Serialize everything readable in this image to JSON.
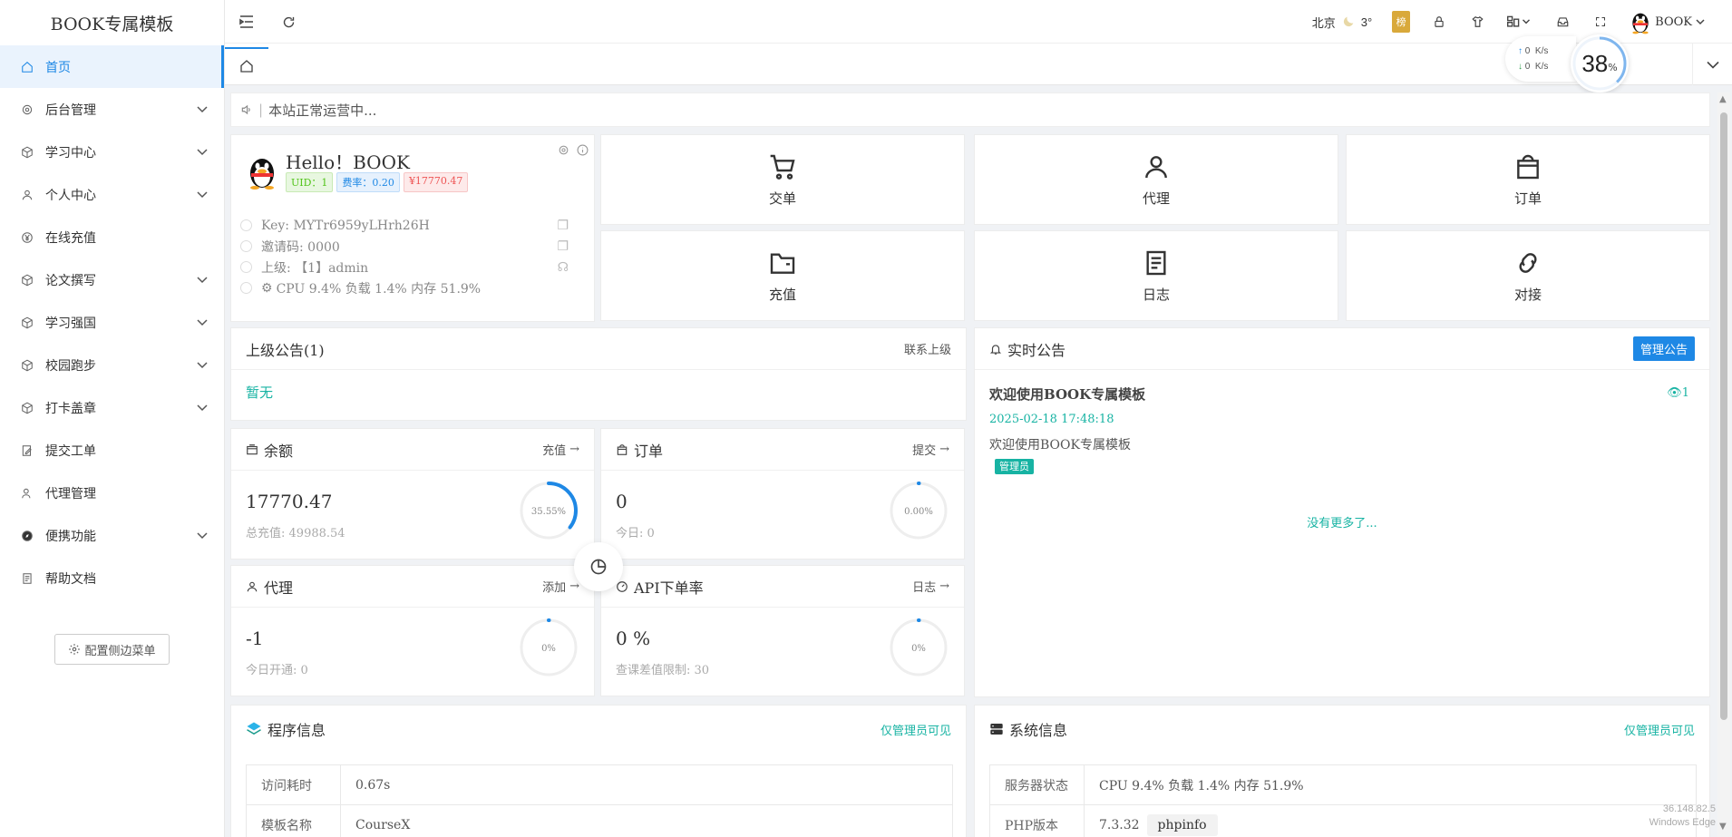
{
  "app": {
    "logo": "BOOK专属模板"
  },
  "sidebar": {
    "items": [
      {
        "label": "首页",
        "icon": "home-icon",
        "active": true,
        "arrow": false
      },
      {
        "label": "后台管理",
        "icon": "gear-icon",
        "arrow": true
      },
      {
        "label": "学习中心",
        "icon": "cube-icon",
        "arrow": true
      },
      {
        "label": "个人中心",
        "icon": "user-icon",
        "arrow": true
      },
      {
        "label": "在线充值",
        "icon": "yen-icon",
        "arrow": false
      },
      {
        "label": "论文撰写",
        "icon": "cube-icon",
        "arrow": true
      },
      {
        "label": "学习强国",
        "icon": "cube-icon",
        "arrow": true
      },
      {
        "label": "校园跑步",
        "icon": "cube-icon",
        "arrow": true
      },
      {
        "label": "打卡盖章",
        "icon": "cube-icon",
        "arrow": true
      },
      {
        "label": "提交工单",
        "icon": "edit-icon",
        "arrow": false
      },
      {
        "label": "代理管理",
        "icon": "users-icon",
        "arrow": false
      },
      {
        "label": "便携功能",
        "icon": "compass-icon",
        "arrow": true
      },
      {
        "label": "帮助文档",
        "icon": "doc-icon",
        "arrow": false
      }
    ],
    "config_label": "配置侧边菜单"
  },
  "topbar": {
    "city": "北京",
    "temp": "3°",
    "rank_badge": "榜",
    "username": "BOOK"
  },
  "net": {
    "up": "0",
    "down": "0",
    "unit": "K/s",
    "gauge": "38",
    "gauge_unit": "%"
  },
  "notice": {
    "text": "本站正常运营中..."
  },
  "user": {
    "hello": "Hello！BOOK",
    "uid_tag": "UID：1",
    "rate_tag": "费率：0.20",
    "balance_tag": "¥17770.47",
    "key": "Key: MYTr6959yLHrh26H",
    "invite": "邀请码: 0000",
    "parent": "上级: 【1】admin",
    "sys": "CPU 9.4%  负载 1.4%  内存 51.9%"
  },
  "quick": [
    {
      "label": "交单",
      "icon": "cart-icon"
    },
    {
      "label": "代理",
      "icon": "user-icon"
    },
    {
      "label": "订单",
      "icon": "bag-icon"
    },
    {
      "label": "充值",
      "icon": "folder-icon"
    },
    {
      "label": "日志",
      "icon": "doc-icon"
    },
    {
      "label": "对接",
      "icon": "link-icon"
    }
  ],
  "parent_notice": {
    "title": "上级公告(1)",
    "link": "联系上级",
    "empty": "暂无"
  },
  "realtime": {
    "title": "实时公告",
    "manage": "管理公告",
    "post_title": "欢迎使用BOOK专属模板",
    "views": "1",
    "date": "2025-02-18 17:48:18",
    "body": "欢迎使用BOOK专属模板",
    "role": "管理员",
    "nomore": "没有更多了..."
  },
  "stats": {
    "balance": {
      "title": "余额",
      "link": "充值",
      "value": "17770.47",
      "sub_label": "总充值:",
      "sub_value": "49988.54",
      "ring": "35.55%",
      "ring_pct": 35.55
    },
    "orders": {
      "title": "订单",
      "link": "提交",
      "value": "0",
      "sub_label": "今日:",
      "sub_value": "0",
      "ring": "0.00%",
      "ring_pct": 0
    },
    "agents": {
      "title": "代理",
      "link": "添加",
      "value": "-1",
      "sub_label": "今日开通:",
      "sub_value": "0",
      "ring": "0%",
      "ring_pct": 0
    },
    "api": {
      "title": "API下单率",
      "link": "日志",
      "value": "0 %",
      "sub_label": "查课差值限制:",
      "sub_value": "30",
      "ring": "0%",
      "ring_pct": 0
    }
  },
  "program": {
    "title": "程序信息",
    "badge": "仅管理员可见",
    "rows": [
      {
        "k": "访问耗时",
        "v": "0.67s"
      },
      {
        "k": "模板名称",
        "v": "CourseX"
      }
    ]
  },
  "system": {
    "title": "系统信息",
    "badge": "仅管理员可见",
    "rows": [
      {
        "k": "服务器状态",
        "v": "CPU 9.4%  负载 1.4%  内存 51.9%"
      },
      {
        "k": "PHP版本",
        "v": "7.3.32",
        "pill": "phpinfo"
      }
    ]
  },
  "watermark": {
    "ip": "36.148.82.5",
    "browser": "Windows Edge"
  }
}
